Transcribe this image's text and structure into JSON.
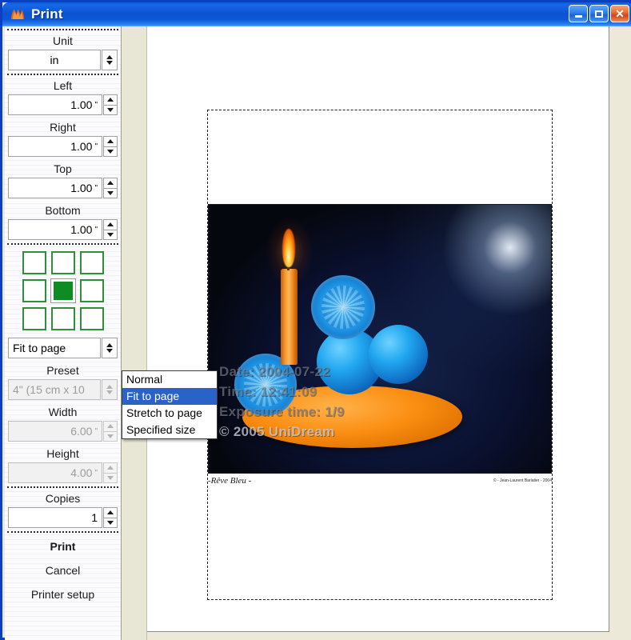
{
  "window": {
    "title": "Print",
    "icon": "flame-icon",
    "buttons": {
      "minimize": "minimize-icon",
      "maximize": "maximize-icon",
      "close": "close-icon"
    }
  },
  "sidebar": {
    "unit": {
      "label": "Unit",
      "value": "in"
    },
    "margins": [
      {
        "label": "Left",
        "value": "1.00",
        "unit": "\""
      },
      {
        "label": "Right",
        "value": "1.00",
        "unit": "\""
      },
      {
        "label": "Top",
        "value": "1.00",
        "unit": "\""
      },
      {
        "label": "Bottom",
        "value": "1.00",
        "unit": "\""
      }
    ],
    "position_grid": {
      "name": "image-position-grid",
      "rows": 3,
      "cols": 3,
      "selected_index": 4
    },
    "scale_mode": {
      "value": "Fit to page",
      "options": [
        "Normal",
        "Fit to page",
        "Stretch to page",
        "Specified size"
      ],
      "selected": "Fit to page"
    },
    "preset": {
      "label": "Preset",
      "value": "4\" (15 cm x 10",
      "disabled": true
    },
    "width": {
      "label": "Width",
      "value": "6.00",
      "unit": "\"",
      "disabled": true
    },
    "height": {
      "label": "Height",
      "value": "4.00",
      "unit": "\"",
      "disabled": true
    },
    "copies": {
      "label": "Copies",
      "value": "1"
    },
    "actions": [
      {
        "label": "Print",
        "primary": true
      },
      {
        "label": "Cancel",
        "primary": false
      },
      {
        "label": "Printer setup",
        "primary": false
      }
    ]
  },
  "preview": {
    "photo": {
      "overlay_lines": [
        "Date: 2004-07-22",
        "Time: 12:41:09",
        "Exposure time: 1/9",
        "© 2005 UniDream"
      ],
      "caption_left": "-Rêve Bleu -",
      "caption_right": "© - Jean-Laurent Barlatier - 2004"
    }
  },
  "colors": {
    "titlebar": "#0b53d0",
    "accent_selected": "#2a63c8",
    "grid_selected": "#0f8b23",
    "sidebar_bg": "#fbfbfd",
    "window_bg": "#ece9d8"
  }
}
